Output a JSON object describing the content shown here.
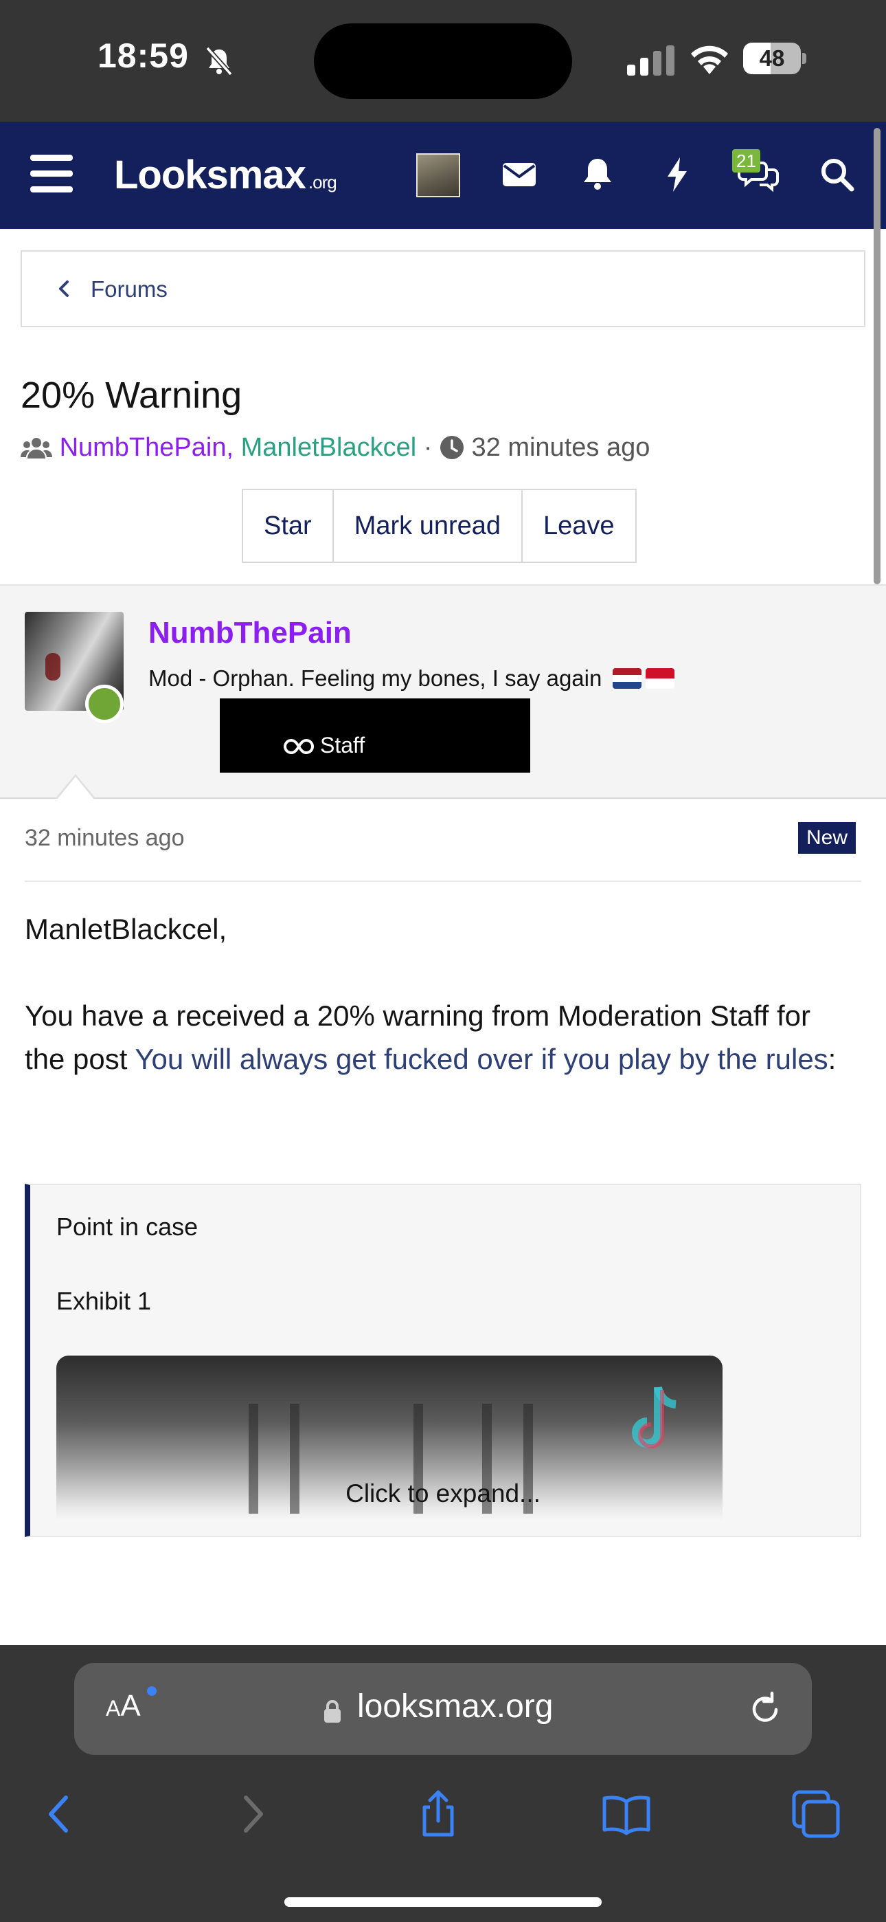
{
  "status_bar": {
    "time": "18:59",
    "battery": "48",
    "battery_level": 0.48
  },
  "navbar": {
    "logo_main": "Looksmax",
    "logo_tld": ".org",
    "conversations_badge": "21",
    "icons": [
      "menu-icon",
      "avatar",
      "mail-icon",
      "bell-icon",
      "lightning-icon",
      "conversations-icon",
      "search-icon"
    ]
  },
  "breadcrumb": {
    "label": "Forums"
  },
  "thread": {
    "title": "20% Warning",
    "participant_1": "NumbThePain",
    "separator": ",",
    "participant_2": "ManletBlackcel",
    "dot": "·",
    "time": "32 minutes ago",
    "buttons": {
      "star": "Star",
      "mark_unread": "Mark unread",
      "leave": "Leave"
    }
  },
  "post": {
    "author": "NumbThePain",
    "author_title": "Mod - Orphan. Feeling my bones, I say again",
    "staff_badge": "Staff",
    "time": "32 minutes ago",
    "new_badge": "New",
    "greeting": "ManletBlackcel,",
    "body_prefix": "You have a received a 20% warning from Moderation Staff for the post ",
    "body_link": "You will always get fucked over if you play by the rules",
    "body_suffix": ":",
    "quote": {
      "line1": "Point in case",
      "line2": "Exhibit 1",
      "expand": "Click to expand..."
    }
  },
  "safari": {
    "aa_label": "AA",
    "url": "looksmax.org"
  },
  "colors": {
    "nav_bg": "#13205c",
    "username_purple": "#8a1ff0",
    "username_teal": "#2aa083",
    "link": "#2d3f73",
    "online": "#70a635"
  }
}
